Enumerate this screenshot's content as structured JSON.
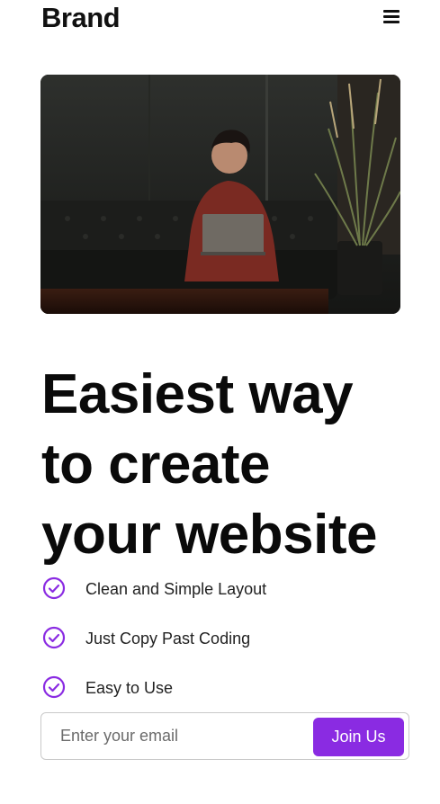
{
  "header": {
    "brand": "Brand",
    "menu_icon": "hamburger-menu-icon"
  },
  "hero": {
    "image_description_icon": "hero-photo",
    "headline_lines": [
      "Easiest way",
      "to create",
      "your website"
    ]
  },
  "features": {
    "icon": "check-circle-icon",
    "items": [
      {
        "label": "Clean and Simple Layout"
      },
      {
        "label": "Just Copy Past Coding"
      },
      {
        "label": "Easy to Use"
      }
    ]
  },
  "signup": {
    "placeholder": "Enter your email",
    "button_label": "Join Us"
  },
  "colors": {
    "accent": "#8a2be2",
    "text": "#0a0a0a",
    "border": "#c9c9c9"
  }
}
